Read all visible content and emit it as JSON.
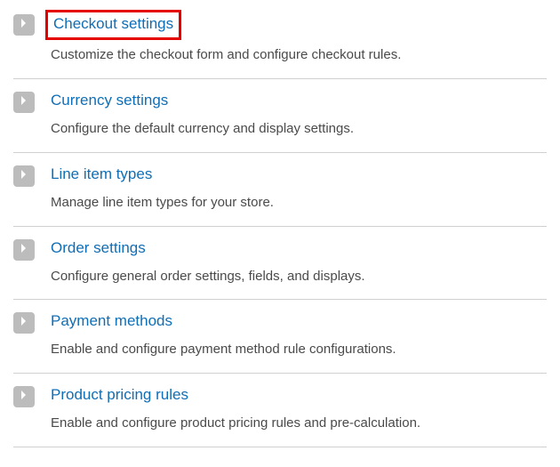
{
  "settings": [
    {
      "id": "checkout-settings",
      "title": "Checkout settings",
      "description": "Customize the checkout form and configure checkout rules.",
      "highlighted": true
    },
    {
      "id": "currency-settings",
      "title": "Currency settings",
      "description": "Configure the default currency and display settings.",
      "highlighted": false
    },
    {
      "id": "line-item-types",
      "title": "Line item types",
      "description": "Manage line item types for your store.",
      "highlighted": false
    },
    {
      "id": "order-settings",
      "title": "Order settings",
      "description": "Configure general order settings, fields, and displays.",
      "highlighted": false
    },
    {
      "id": "payment-methods",
      "title": "Payment methods",
      "description": "Enable and configure payment method rule configurations.",
      "highlighted": false
    },
    {
      "id": "product-pricing-rules",
      "title": "Product pricing rules",
      "description": "Enable and configure product pricing rules and pre-calculation.",
      "highlighted": false
    }
  ]
}
